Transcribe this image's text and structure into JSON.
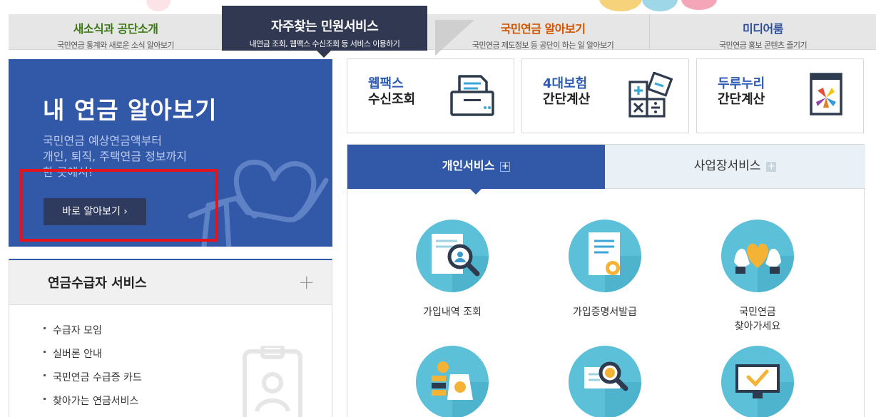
{
  "tabs": [
    {
      "title": "새소식과 공단소개",
      "sub": "국민연금 통계와 새로운 소식 알아보기"
    },
    {
      "title": "자주찾는 민원서비스",
      "sub": "내연금 조회, 웹팩스 수신조회 등 서비스 이용하기"
    },
    {
      "title": "국민연금 알아보기",
      "sub": "국민연금 제도정보 등 공단이 하는 일 알아보기"
    },
    {
      "title": "미디어룸",
      "sub": "국민연금 홍보 콘텐츠 즐기기"
    }
  ],
  "hero": {
    "title": "내 연금 알아보기",
    "desc": "국민연금 예상연금액부터\n개인, 퇴직, 주택연금 정보까지\n한 곳에서!",
    "button": "바로 알아보기 ›"
  },
  "pensioner": {
    "title": "연금수급자 서비스",
    "plus": "+",
    "items": [
      "수급자 모임",
      "실버론 안내",
      "국민연금 수급증 카드",
      "찾아가는 연금서비스"
    ]
  },
  "quick": [
    {
      "line1": "웹팩스",
      "line2": "수신조회",
      "icon": "fax-icon"
    },
    {
      "line1": "4대보험",
      "line2": "간단계산",
      "icon": "calculator-icon"
    },
    {
      "line1": "두루누리",
      "line2": "간단계산",
      "icon": "durunuri-icon"
    }
  ],
  "service_tabs": {
    "personal": "개인서비스",
    "business": "사업장서비스",
    "plus": "+"
  },
  "services": [
    {
      "label": "가입내역 조회",
      "icon": "document-search-icon"
    },
    {
      "label": "가입증명서발급",
      "icon": "certificate-icon"
    },
    {
      "label": "국민연금\n찾아가세요",
      "icon": "heart-hands-icon"
    },
    {
      "label": "",
      "icon": "money-bag-icon"
    },
    {
      "label": "",
      "icon": "card-search-icon"
    },
    {
      "label": "",
      "icon": "monitor-check-icon"
    }
  ],
  "colors": {
    "primary": "#3159a8",
    "dark": "#303852",
    "highlight": "#e4141e",
    "circle": "#5bc0d8"
  }
}
